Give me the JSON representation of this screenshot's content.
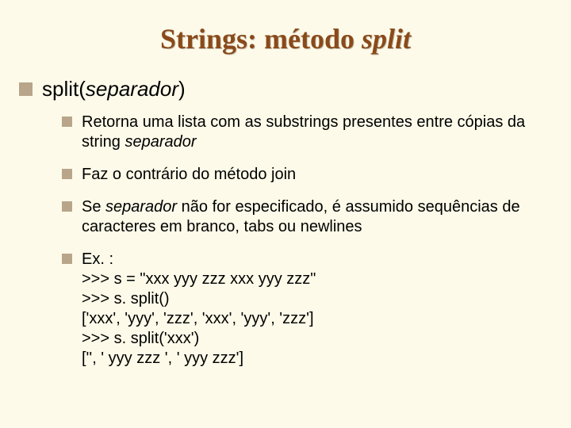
{
  "title": {
    "plain": "Strings: método ",
    "italic": "split"
  },
  "main": {
    "method_name": "split(",
    "method_arg_italic": "separador",
    "method_close": ")"
  },
  "sub": [
    {
      "pre": "Retorna uma lista com as substrings presentes entre cópias da string ",
      "italic": "separador",
      "post": ""
    },
    {
      "pre": "Faz o contrário do método join",
      "italic": "",
      "post": ""
    },
    {
      "pre": "Se ",
      "italic": "separador",
      "post": " não for especificado, é assumido sequências de caracteres em branco, tabs ou newlines"
    }
  ],
  "example": {
    "label": "Ex. :",
    "lines": [
      ">>> s = \"xxx yyy zzz  xxx  yyy zzz\"",
      ">>> s. split()",
      "['xxx', 'yyy', 'zzz', 'xxx', 'yyy', 'zzz']",
      ">>> s. split('xxx')",
      "['', ' yyy zzz  ', '  yyy zzz']"
    ]
  }
}
